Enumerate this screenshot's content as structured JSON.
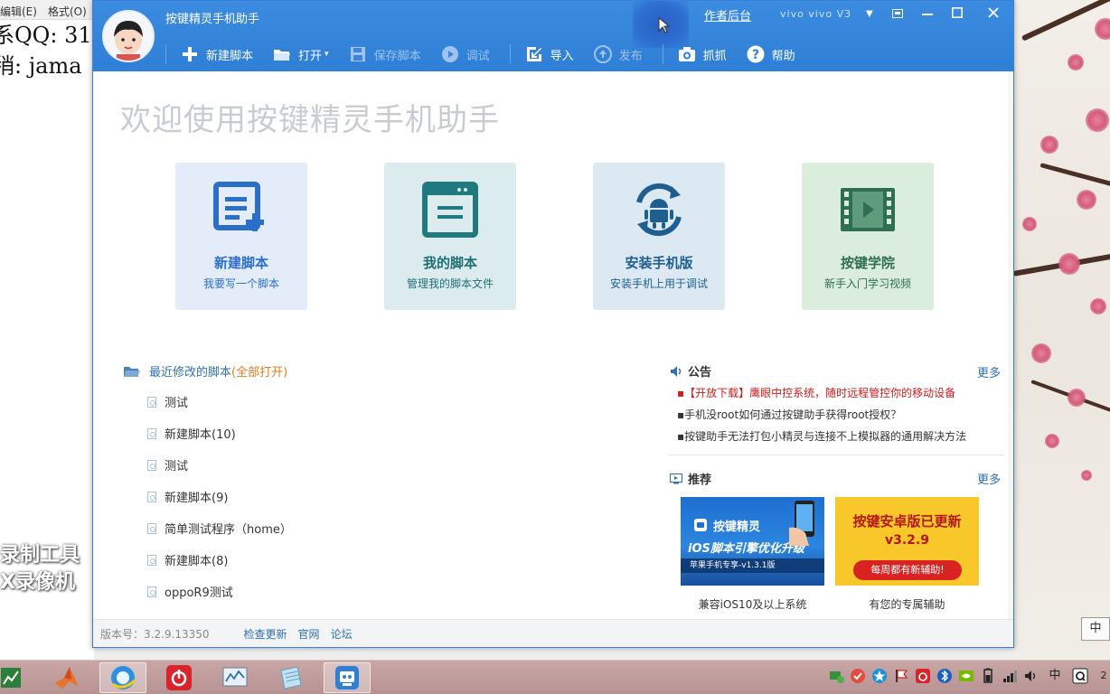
{
  "desktop": {
    "editor_menu": [
      "编辑(E)",
      "格式(O)"
    ],
    "editor_lines": [
      "系QQ: 31",
      "稍: jama"
    ],
    "watermark_lines": [
      "录制工具",
      "X录像机"
    ],
    "ime_indicator": "中"
  },
  "window": {
    "title": "按键精灵手机助手",
    "author_link": "作者后台",
    "device_name": "vivo  vivo V3",
    "toolbar": {
      "new_script": "新建脚本",
      "open": "打开",
      "save_script": "保存脚本",
      "debug": "调试",
      "import": "导入",
      "publish": "发布",
      "capture": "抓抓",
      "help": "帮助"
    }
  },
  "welcome": "欢迎使用按键精灵手机助手",
  "tiles": [
    {
      "title": "新建脚本",
      "subtitle": "我要写一个脚本",
      "icon": "new-script-icon"
    },
    {
      "title": "我的脚本",
      "subtitle": "管理我的脚本文件",
      "icon": "my-scripts-icon"
    },
    {
      "title": "安装手机版",
      "subtitle": "安装手机上用于调试",
      "icon": "android-install-icon"
    },
    {
      "title": "按键学院",
      "subtitle": "新手入门学习视频",
      "icon": "video-icon"
    }
  ],
  "recent": {
    "heading": "最近修改的脚本",
    "open_all": "(全部打开)",
    "items": [
      "测试",
      "新建脚本(10)",
      "测试",
      "新建脚本(9)",
      "简单测试程序（home）",
      "新建脚本(8)",
      "oppoR9测试"
    ]
  },
  "announcements": {
    "heading": "公告",
    "more": "更多",
    "items": [
      "▪【开放下载】鹰眼中控系统，随时远程管控你的移动设备",
      "▪手机没root如何通过按键助手获得root授权？",
      "▪按键助手无法打包小精灵与连接不上模拟器的通用解决方法"
    ]
  },
  "recommend": {
    "heading": "推荐",
    "more": "更多",
    "items": [
      {
        "banner_brand": "按键精灵",
        "banner_title": "iOS脚本引擎优化升级",
        "banner_sub": "苹果手机专享-v1.3.1版",
        "caption": "兼容iOS10及以上系统"
      },
      {
        "banner_title": "按键安卓版已更新",
        "banner_version": "v3.2.9",
        "banner_sub": "每周都有新辅助!",
        "caption": "有您的专属辅助"
      }
    ]
  },
  "status": {
    "version": "版本号：3.2.9.13350",
    "check_update": "检查更新",
    "website": "官网",
    "forum": "论坛"
  },
  "taskbar": {
    "tray_ime": "中",
    "clock_fragment": "2"
  },
  "colors": {
    "titlebar": "#2f7fd6",
    "link": "#2f6fb3",
    "hot_notice": "#d21b1b",
    "open_all": "#e07b1c"
  }
}
